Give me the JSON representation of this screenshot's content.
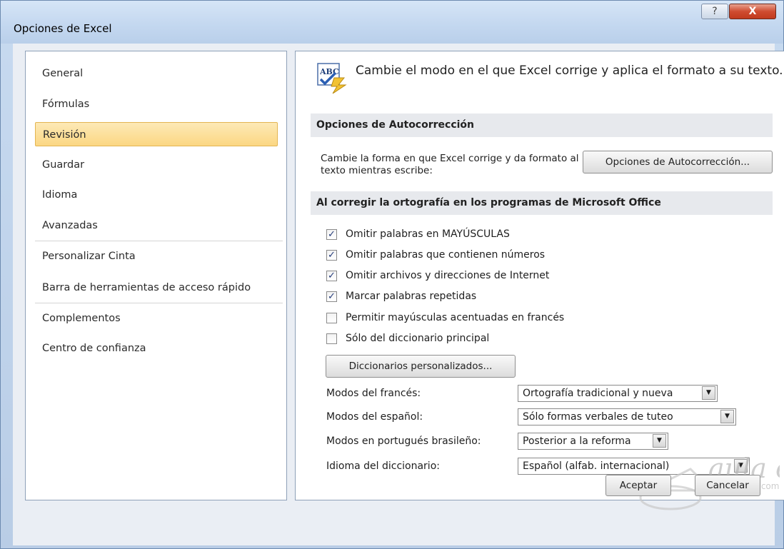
{
  "window": {
    "title": "Opciones de Excel",
    "help_symbol": "?",
    "close_symbol": "X"
  },
  "nav": {
    "items": [
      {
        "label": "General"
      },
      {
        "label": "Fórmulas"
      },
      {
        "label": "Revisión",
        "selected": true
      },
      {
        "label": "Guardar"
      },
      {
        "label": "Idioma"
      },
      {
        "label": "Avanzadas"
      },
      {
        "label": "Personalizar Cinta"
      },
      {
        "label": "Barra de herramientas de acceso rápido"
      },
      {
        "label": "Complementos"
      },
      {
        "label": "Centro de confianza"
      }
    ]
  },
  "content": {
    "icon": "abc-proofing-icon",
    "header": "Cambie el modo en el que Excel corrige y aplica el formato a su texto.",
    "autocorrect_section": {
      "title": "Opciones de Autocorrección",
      "description": "Cambie la forma en que Excel corrige y da formato al texto mientras escribe:",
      "button_label": "Opciones de Autocorrección..."
    },
    "spelling_section": {
      "title": "Al corregir la ortografía en los programas de Microsoft Office",
      "checkboxes": [
        {
          "label": "Omitir palabras en MAYÚSCULAS",
          "checked": true
        },
        {
          "label": "Omitir palabras que contienen números",
          "checked": true
        },
        {
          "label": "Omitir archivos y direcciones de Internet",
          "checked": true
        },
        {
          "label": "Marcar palabras repetidas",
          "checked": true
        },
        {
          "label": "Permitir mayúsculas acentuadas en francés",
          "checked": false
        },
        {
          "label": "Sólo del diccionario principal",
          "checked": false
        }
      ],
      "custom_dict_button": "Diccionarios personalizados...",
      "modes": [
        {
          "label": "Modos del francés:",
          "value": "Ortografía tradicional y nueva"
        },
        {
          "label": "Modos del español:",
          "value": "Sólo formas verbales de tuteo"
        },
        {
          "label": "Modos en portugués brasileño:",
          "value": "Posterior a la reforma"
        },
        {
          "label": "Idioma del diccionario:",
          "value": "Español (alfab. internacional)"
        }
      ]
    }
  },
  "footer": {
    "ok_label": "Aceptar",
    "cancel_label": "Cancelar"
  },
  "watermark": {
    "text": "aula clic",
    "domain": ".com"
  },
  "colors": {
    "selected_bg": "#fbd783",
    "title_bg": "#c4d8f0",
    "close_btn": "#cf4c31"
  }
}
